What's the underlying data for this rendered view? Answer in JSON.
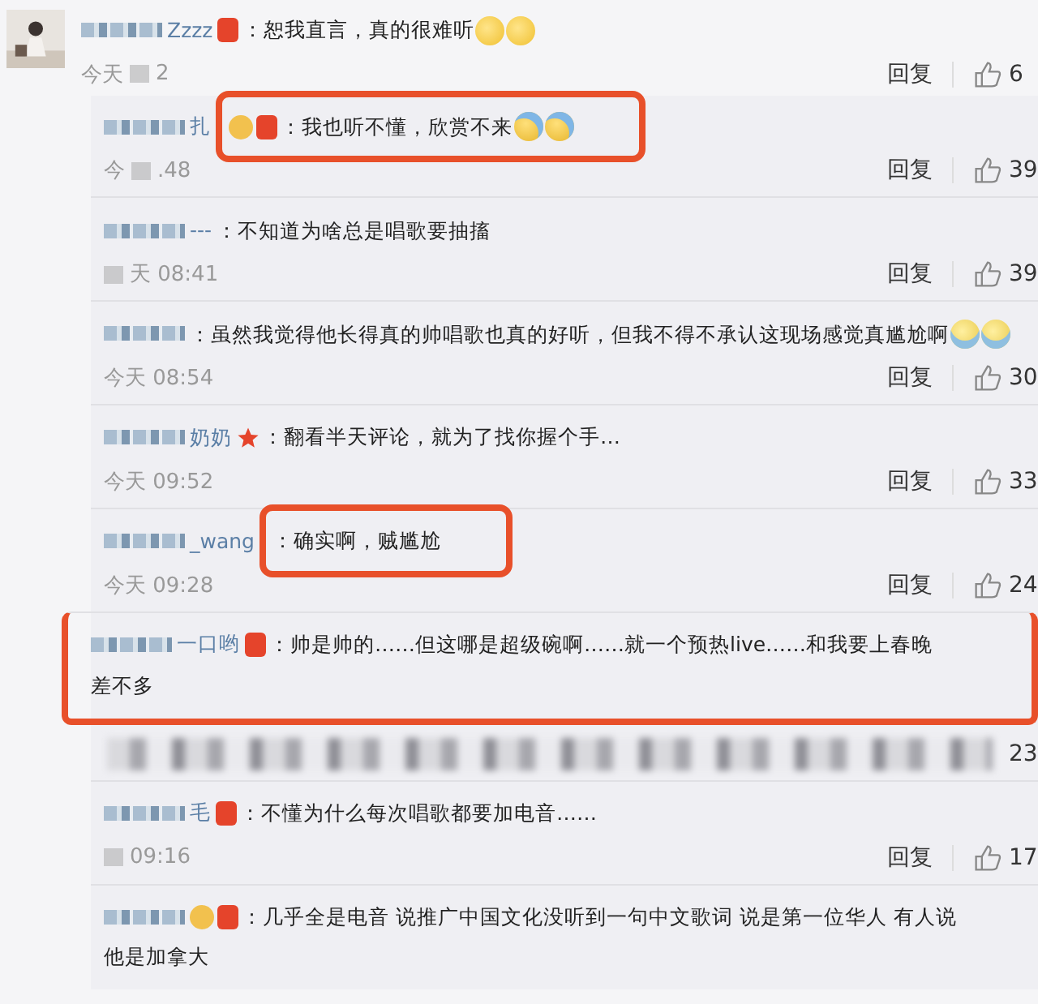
{
  "comment": {
    "name_suffix": "Zzzz",
    "badges": [
      {
        "kind": "envelope"
      }
    ],
    "text": "：恕我直言，真的很难听",
    "emojis": [
      {
        "kind": "smile"
      },
      {
        "kind": "smile"
      }
    ],
    "time_parts": [
      "今天",
      "2"
    ],
    "blur_before": false,
    "reply_label": "回复",
    "likes": "6"
  },
  "replies": [
    {
      "kind": "reply",
      "name_suffix": "扎",
      "badges": [
        {
          "kind": "vip"
        },
        {
          "kind": "envelope"
        }
      ],
      "text": "：我也听不懂，欣赏不来",
      "emojis": [
        {
          "kind": "laugh"
        },
        {
          "kind": "laugh"
        }
      ],
      "time_parts": [
        "今",
        ".48"
      ],
      "blur_before": false,
      "reply_label": "回复",
      "likes": "39",
      "highlight": {
        "kind": "text"
      }
    },
    {
      "kind": "reply",
      "name_suffix": "---",
      "text": "：不知道为啥总是唱歌要抽搐",
      "time_parts": [
        "天 08:41"
      ],
      "blur_before": true,
      "reply_label": "回复",
      "likes": "39"
    },
    {
      "kind": "reply",
      "text": "：虽然我觉得他长得真的帅唱歌也真的好听，但我不得不承认这现场感觉真尴尬啊",
      "emojis": [
        {
          "kind": "shy"
        },
        {
          "kind": "shy"
        }
      ],
      "time_parts": [
        "今天 08:54"
      ],
      "blur_before": false,
      "reply_label": "回复",
      "likes": "30"
    },
    {
      "kind": "reply",
      "name_suffix": "奶奶",
      "badges": [
        {
          "kind": "star"
        }
      ],
      "text": "：翻看半天评论，就为了找你握个手…",
      "time_parts": [
        "今天 09:52"
      ],
      "blur_before": false,
      "reply_label": "回复",
      "likes": "33"
    },
    {
      "kind": "reply",
      "name_suffix": "_wang",
      "text": "：确实啊，贼尴尬",
      "time_parts": [
        "今天 09:28"
      ],
      "blur_before": false,
      "reply_label": "回复",
      "likes": "24",
      "highlight": {
        "kind": "text"
      }
    },
    {
      "kind": "reply",
      "name_suffix": "一口哟",
      "badges": [
        {
          "kind": "envelope"
        }
      ],
      "text": "：帅是帅的……但这哪是超级碗啊……就一个预热live……和我要上春晚",
      "text_continued": "差不多",
      "highlight": {
        "kind": "row"
      }
    },
    {
      "kind": "blurred",
      "likes": "23"
    },
    {
      "kind": "reply",
      "name_suffix": "毛",
      "badges": [
        {
          "kind": "envelope"
        }
      ],
      "text": "：不懂为什么每次唱歌都要加电音……",
      "time_parts": [
        "09:16"
      ],
      "blur_before": true,
      "reply_label": "回复",
      "likes": "17"
    },
    {
      "kind": "reply",
      "badges": [
        {
          "kind": "vip"
        },
        {
          "kind": "envelope"
        }
      ],
      "text": "：几乎全是电音 说推广中国文化没听到一句中文歌词 说是第一位华人 有人说",
      "text_continued": "他是加拿大"
    }
  ]
}
